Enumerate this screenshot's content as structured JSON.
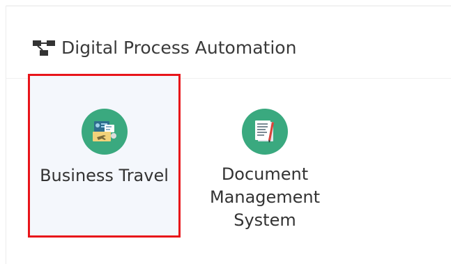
{
  "section": {
    "title": "Digital Process Automation",
    "icon": "workflow-icon"
  },
  "tiles": [
    {
      "label": "Business Travel",
      "icon": "business-travel-icon"
    },
    {
      "label": "Document\nManagement\nSystem",
      "icon": "document-management-icon"
    }
  ],
  "colors": {
    "icon_circle": "#3aa97f",
    "highlight_border": "#e8141a",
    "selected_tile_bg": "#f4f7fc"
  }
}
